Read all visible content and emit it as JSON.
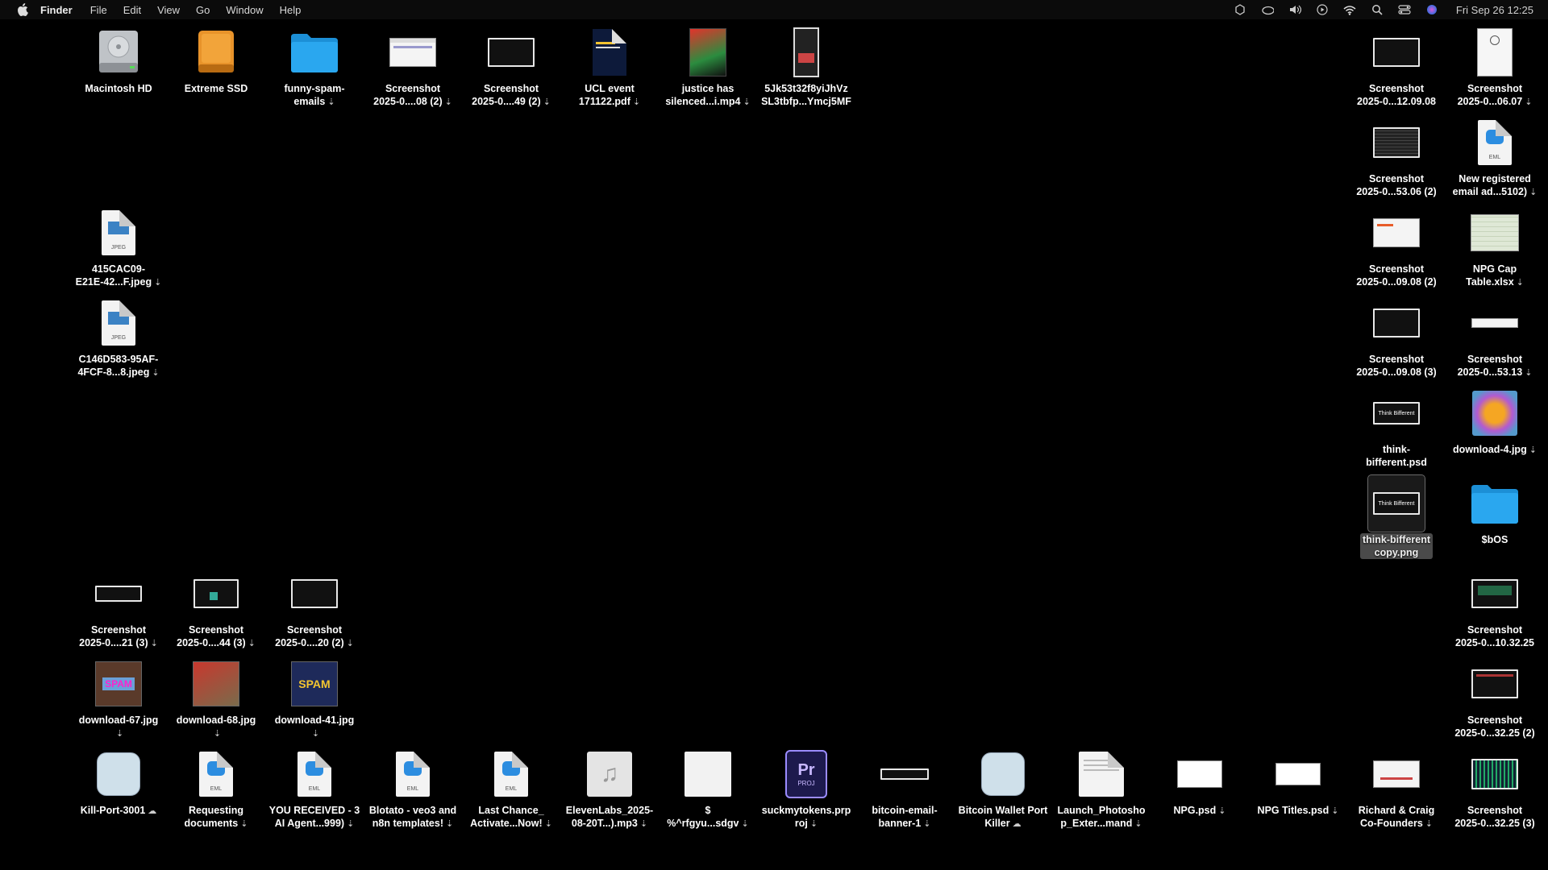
{
  "menubar": {
    "app_name": "Finder",
    "menus": [
      "File",
      "Edit",
      "View",
      "Go",
      "Window",
      "Help"
    ],
    "clock": "Fri Sep 26  12:25"
  },
  "colors": {
    "desktop": "#000000",
    "folder": "#1aa3f0",
    "accent": "#e85d2a"
  },
  "icons": {
    "macintosh-hd": {
      "label": "Macintosh HD",
      "cloud": ""
    },
    "extreme-ssd": {
      "label": "Extreme SSD",
      "cloud": ""
    },
    "funny-spam-emails": {
      "label": "funny-spam-\nemails",
      "cloud": "⇣"
    },
    "screenshot-08-2": {
      "label": "Screenshot\n2025-0....08 (2)",
      "cloud": "⇣"
    },
    "screenshot-49-2": {
      "label": "Screenshot\n2025-0....49 (2)",
      "cloud": "⇣"
    },
    "ucl-event": {
      "label": "UCL event\n171122.pdf",
      "cloud": "⇣"
    },
    "justice": {
      "label": "justice has\nsilenced...i.mp4",
      "cloud": "⇣"
    },
    "5jk53": {
      "label": "5Jk53t32f8yiJhVz\nSL3tbfp...Ymcj5MF",
      "cloud": ""
    },
    "jpeg-415": {
      "label": "415CAC09-\nE21E-42...F.jpeg",
      "cloud": "⇣"
    },
    "jpeg-c146": {
      "label": "C146D583-95AF-\n4FCF-8...8.jpeg",
      "cloud": "⇣"
    },
    "shot-21-3": {
      "label": "Screenshot\n2025-0....21 (3)",
      "cloud": "⇣"
    },
    "shot-44-3": {
      "label": "Screenshot\n2025-0....44 (3)",
      "cloud": "⇣"
    },
    "shot-20-2": {
      "label": "Screenshot\n2025-0....20 (2)",
      "cloud": "⇣"
    },
    "dl-67": {
      "label": "download-67.jpg",
      "cloud": "⇣"
    },
    "dl-68": {
      "label": "download-68.jpg",
      "cloud": "⇣"
    },
    "dl-41": {
      "label": "download-41.jpg",
      "cloud": "⇣"
    },
    "kill-port": {
      "label": "Kill-Port-3001",
      "cloud": "☁"
    },
    "requesting-docs": {
      "label": "Requesting\ndocuments",
      "cloud": "⇣"
    },
    "you-received": {
      "label": "YOU RECEIVED - 3\nAI Agent...999)",
      "cloud": "⇣"
    },
    "blotato": {
      "label": "Blotato - veo3 and\nn8n templates!",
      "cloud": "⇣"
    },
    "last-chance": {
      "label": "Last Chance_\nActivate...Now!",
      "cloud": "⇣"
    },
    "elevenlabs": {
      "label": "ElevenLabs_2025-\n08-20T...).mp3",
      "cloud": "⇣"
    },
    "dollar-sdgv": {
      "label": "$\n%^rfgyu...sdgv",
      "cloud": "⇣"
    },
    "suckmytokens": {
      "label": "suckmytokens.prp\nroj",
      "cloud": "⇣"
    },
    "bitcoin-banner": {
      "label": "bitcoin-email-\nbanner-1",
      "cloud": "⇣"
    },
    "bitcoin-wallet": {
      "label": "Bitcoin Wallet Port\nKiller",
      "cloud": "☁"
    },
    "launch-photoshop": {
      "label": "Launch_Photosho\np_Exter...mand",
      "cloud": "⇣"
    },
    "npg-psd": {
      "label": "NPG.psd",
      "cloud": "⇣"
    },
    "npg-titles": {
      "label": "NPG Titles.psd",
      "cloud": "⇣"
    },
    "richard-craig": {
      "label": "Richard & Craig\nCo-Founders",
      "cloud": "⇣"
    },
    "shot-3225-3": {
      "label": "Screenshot\n2025-0...32.25 (3)",
      "cloud": ""
    },
    "r-shot-1209": {
      "label": "Screenshot\n2025-0...12.09.08",
      "cloud": ""
    },
    "r-shot-0607": {
      "label": "Screenshot\n2025-0...06.07",
      "cloud": "⇣"
    },
    "r-shot-5306": {
      "label": "Screenshot\n2025-0...53.06 (2)",
      "cloud": ""
    },
    "new-registered": {
      "label": "New registered\nemail ad...5102)",
      "cloud": "⇣"
    },
    "r-shot-0908-2": {
      "label": "Screenshot\n2025-0...09.08 (2)",
      "cloud": ""
    },
    "npg-cap": {
      "label": "NPG Cap\nTable.xlsx",
      "cloud": "⇣"
    },
    "r-shot-0908-3": {
      "label": "Screenshot\n2025-0...09.08 (3)",
      "cloud": ""
    },
    "r-shot-5313": {
      "label": "Screenshot\n2025-0...53.13",
      "cloud": "⇣"
    },
    "think-bifferent": {
      "label": "think-\nbifferent.psd",
      "cloud": ""
    },
    "download-4": {
      "label": "download-4.jpg",
      "cloud": "⇣"
    },
    "think-copy": {
      "label": "think-bifferent\ncopy.png",
      "cloud": ""
    },
    "bos": {
      "label": "$bOS",
      "cloud": ""
    },
    "r-shot-1032": {
      "label": "Screenshot\n2025-0...10.32.25",
      "cloud": ""
    },
    "r-shot-3225-2": {
      "label": "Screenshot\n2025-0...32.25 (2)",
      "cloud": ""
    }
  },
  "thumb_text": {
    "think": "Think Bifferent",
    "jpeg": "JPEG",
    "eml": "EML",
    "proj": "PROJ",
    "pr": "Pr",
    "spam": "SPAM"
  }
}
